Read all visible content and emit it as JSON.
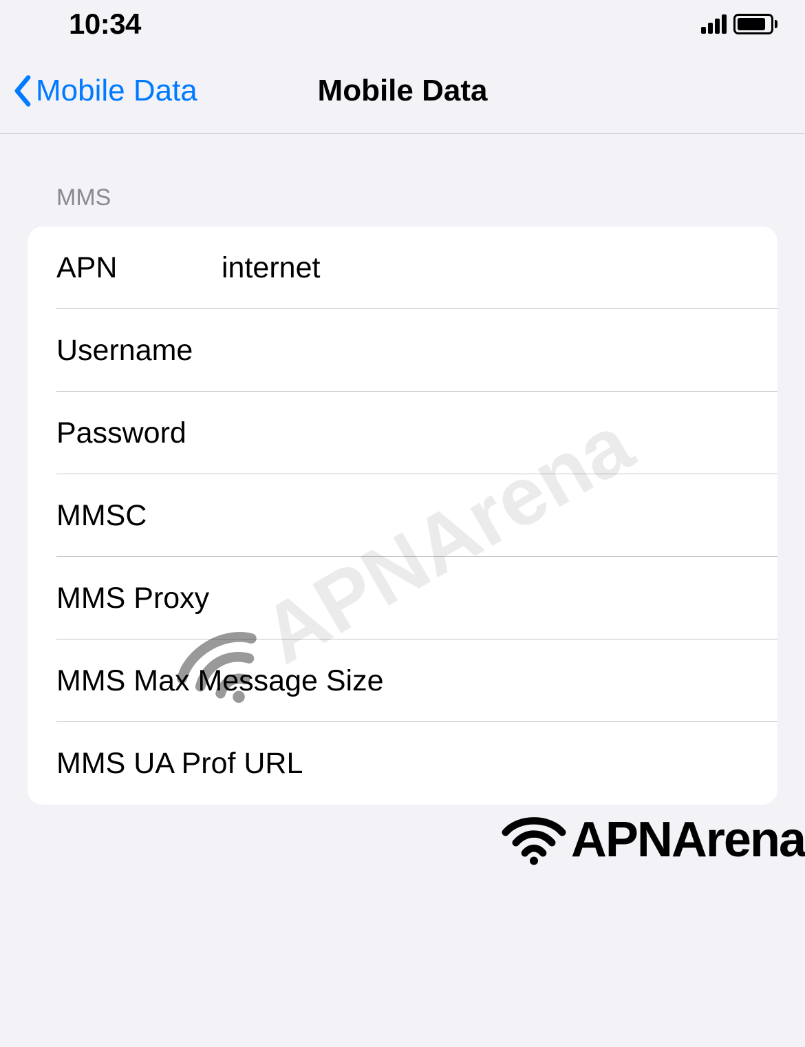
{
  "status_bar": {
    "time": "10:34"
  },
  "nav": {
    "back_label": "Mobile Data",
    "title": "Mobile Data"
  },
  "section": {
    "header": "MMS",
    "fields": {
      "apn": {
        "label": "APN",
        "value": "internet"
      },
      "username": {
        "label": "Username",
        "value": ""
      },
      "password": {
        "label": "Password",
        "value": ""
      },
      "mmsc": {
        "label": "MMSC",
        "value": ""
      },
      "mms_proxy": {
        "label": "MMS Proxy",
        "value": ""
      },
      "mms_max_size": {
        "label": "MMS Max Message Size",
        "value": ""
      },
      "mms_ua_prof": {
        "label": "MMS UA Prof URL",
        "value": ""
      }
    }
  },
  "watermark": "APNArena",
  "branding": "APNArena"
}
